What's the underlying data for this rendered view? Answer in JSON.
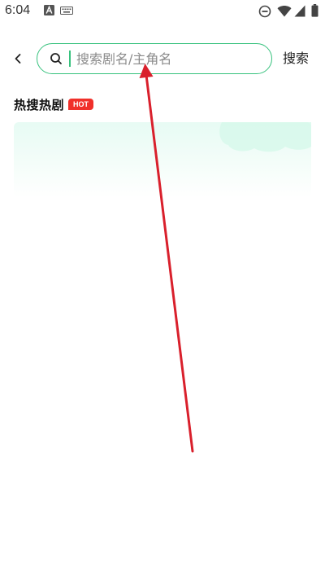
{
  "status_bar": {
    "time": "6:04",
    "icons": [
      "a-letter-icon",
      "keyboard-icon",
      "do-not-disturb-icon",
      "wifi-icon",
      "signal-icon",
      "battery-icon"
    ]
  },
  "header": {
    "back_icon": "chevron-left-icon",
    "search": {
      "icon": "search-icon",
      "placeholder": "搜索剧名/主角名",
      "value": ""
    },
    "search_button_label": "搜索"
  },
  "hot_section": {
    "title": "热搜热剧",
    "badge": "HOT"
  },
  "colors": {
    "accent": "#38c27e",
    "badge_red": "#f0302a",
    "panel_tint": "#e7fbf4",
    "annotation_red": "#d9202c"
  }
}
